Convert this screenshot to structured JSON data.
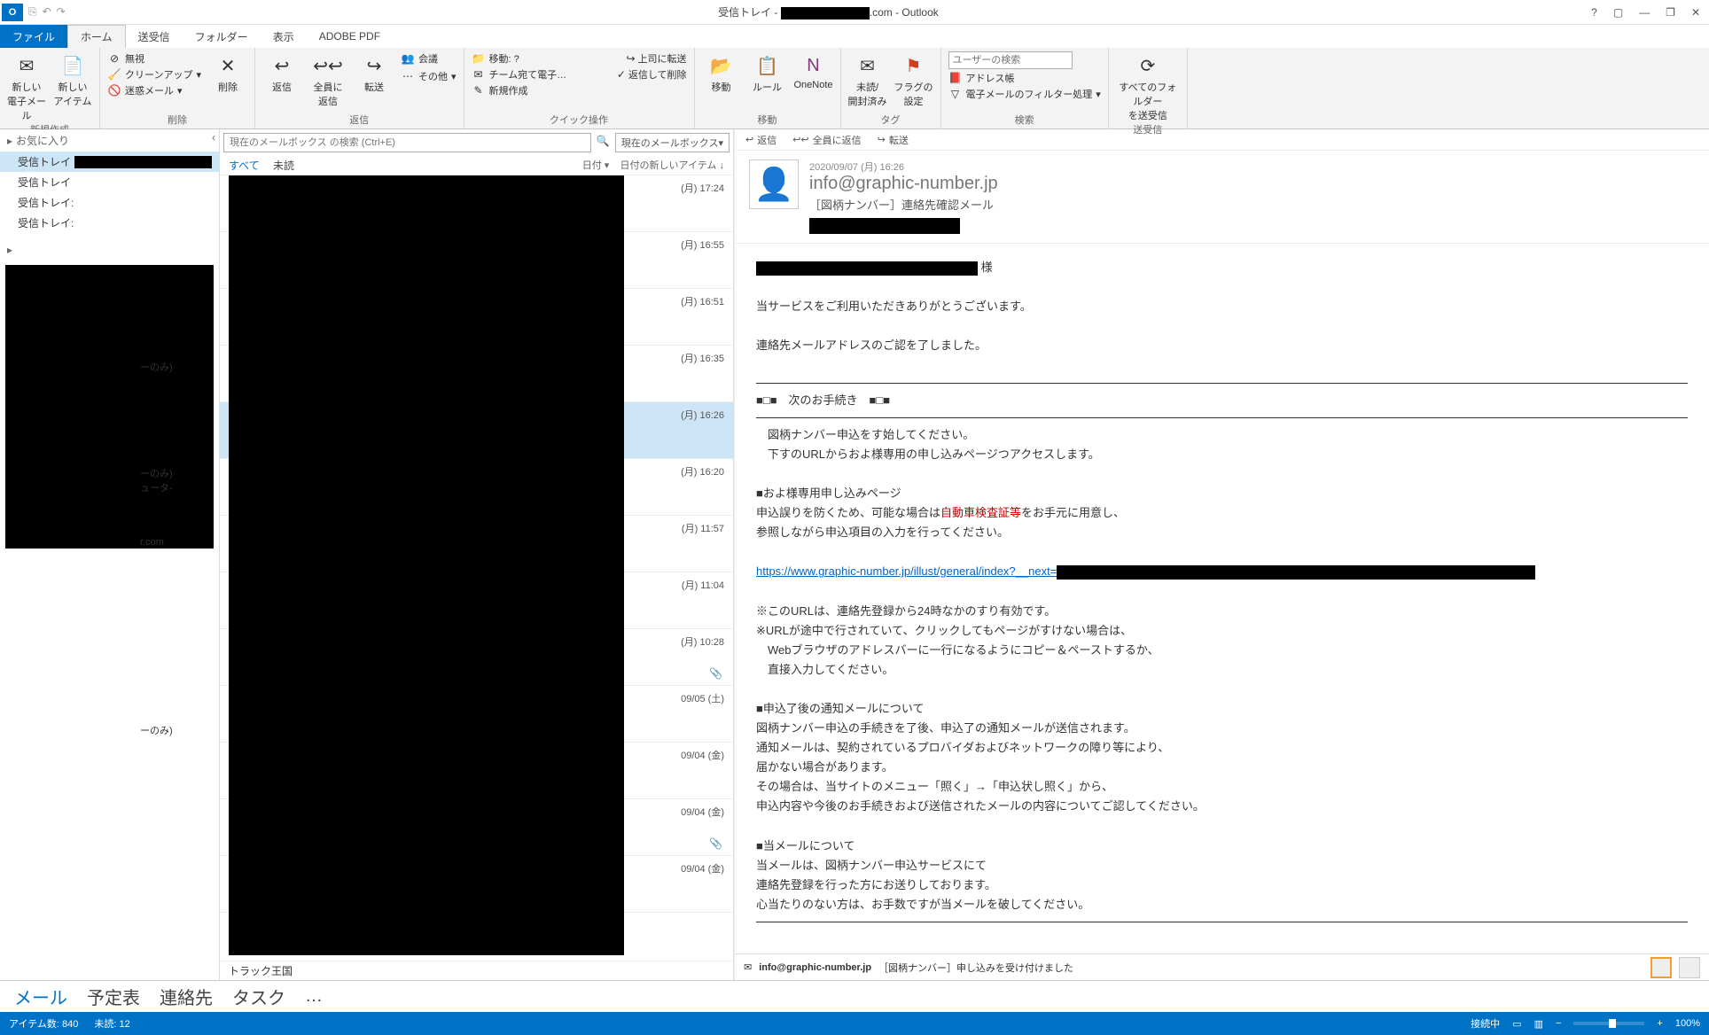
{
  "titlebar": {
    "title_prefix": "受信トレイ - ",
    "title_suffix": ".com - Outlook"
  },
  "tabs": {
    "file": "ファイル",
    "home": "ホーム",
    "sendrecv": "送受信",
    "folder": "フォルダー",
    "view": "表示",
    "adobe": "ADOBE PDF"
  },
  "ribbon": {
    "new_mail": "新しい\n電子メール",
    "new_item": "新しい\nアイテム",
    "group_new": "新規作成",
    "ignore": "無視",
    "cleanup": "クリーンアップ",
    "junk": "迷惑メール",
    "delete": "削除",
    "group_delete": "削除",
    "reply": "返信",
    "reply_all": "全員に\n返信",
    "forward": "転送",
    "meeting": "会議",
    "more": "その他",
    "group_reply": "返信",
    "move_q": "移動: ?",
    "to_boss": "上司に転送",
    "team_mail": "チーム宛て電子…",
    "reply_delete": "返信して削除",
    "new_create": "新規作成",
    "group_quick": "クイック操作",
    "move": "移動",
    "rules": "ルール",
    "onenote": "OneNote",
    "group_move": "移動",
    "unread": "未読/\n開封済み",
    "flag": "フラグの\n設定",
    "group_tag": "タグ",
    "search_placeholder": "ユーザーの検索",
    "addressbook": "アドレス帳",
    "filter": "電子メールのフィルター処理",
    "group_search": "検索",
    "sendrecv_all": "すべてのフォルダー\nを送受信",
    "group_sendrecv": "送受信"
  },
  "nav": {
    "fav": "お気に入り",
    "inbox": "受信トレイ",
    "peek1": "ーのみ)",
    "peek2": "ーのみ)",
    "peek3": "ュータ-",
    "peek4": "r.com",
    "peek5": "ーのみ)",
    "trackland": "トラック王国"
  },
  "list": {
    "search_placeholder": "現在のメールボックス の検索 (Ctrl+E)",
    "scope": "現在のメールボックス",
    "all": "すべて",
    "unread": "未読",
    "sort_by": "日付",
    "sort_order": "日付の新しいアイテム ↓",
    "items": [
      {
        "time": "(月) 17:24",
        "attach": false
      },
      {
        "time": "(月) 16:55",
        "attach": false
      },
      {
        "time": "(月) 16:51",
        "attach": false
      },
      {
        "time": "(月) 16:35",
        "attach": false
      },
      {
        "time": "(月) 16:26",
        "attach": false,
        "selected": true
      },
      {
        "time": "(月) 16:20",
        "attach": false
      },
      {
        "time": "(月) 11:57",
        "attach": false
      },
      {
        "time": "(月) 11:04",
        "attach": false
      },
      {
        "time": "(月) 10:28",
        "attach": true
      },
      {
        "time": "09/05 (土)",
        "attach": false
      },
      {
        "time": "09/04 (金)",
        "attach": false
      },
      {
        "time": "09/04 (金)",
        "attach": true
      },
      {
        "time": "09/04 (金)",
        "attach": false
      }
    ]
  },
  "reader": {
    "act_reply": "返信",
    "act_reply_all": "全員に返信",
    "act_forward": "転送",
    "date": "2020/09/07 (月) 16:26",
    "from": "info@graphic-number.jp",
    "subject": "［図柄ナンバー］連絡先確認メール",
    "l_sama": " 様",
    "l1": "当サービスをご利用いただきありがとうございます。",
    "l2": "連絡先メールアドレスのご認を了しました。",
    "l_next": "■□■　次のお手続き　■□■",
    "l3": "　図柄ナンバー申込をす始してください。",
    "l4": "　下すのURLからおよ様専用の申し込みページつアクセスします。",
    "l5": "■およ様専用申し込みページ",
    "l6a": "申込誤りを防くため、可能な場合は",
    "l6b": "自動車検査証等",
    "l6c": "をお手元に用意し、",
    "l7": "参照しながら申込項目の入力を行ってください。",
    "link": "https://www.graphic-number.jp/illust/general/index?__next=",
    "l8": "※このURLは、連絡先登録から24時なかのすり有効です。",
    "l9": "※URLが途中で行されていて、クリックしてもページがすけない場合は、",
    "l10": "　Webブラウザのアドレスバーに一行になるようにコピー＆ペーストするか、",
    "l11": "　直接入力してください。",
    "l12": "■申込了後の通知メールについて",
    "l13": "図柄ナンバー申込の手続きを了後、申込了の通知メールが送信されます。",
    "l14": "通知メールは、契約されているプロバイダおよびネットワークの障り等により、",
    "l15": "届かない場合があります。",
    "l16": "その場合は、当サイトのメニュー「照く」→「申込状し照く」から、",
    "l17": "申込内容や今後のお手続きおよび送信されたメールの内容についてご認してください。",
    "l18": "■当メールについて",
    "l19": "当メールは、図柄ナンバー申込サービスにて",
    "l20": "連絡先登録を行った方にお送りしております。",
    "l21": "心当たりのない方は、お手数ですが当メールを破してください。",
    "thread_from": "info@graphic-number.jp",
    "thread_subj": "［図柄ナンバー］申し込みを受け付けました"
  },
  "bottom": {
    "mail": "メール",
    "cal": "予定表",
    "contacts": "連絡先",
    "tasks": "タスク",
    "more": "…"
  },
  "status": {
    "items": "アイテム数: 840",
    "unread": "未読: 12",
    "conn": "接続中",
    "zoom": "100%"
  }
}
